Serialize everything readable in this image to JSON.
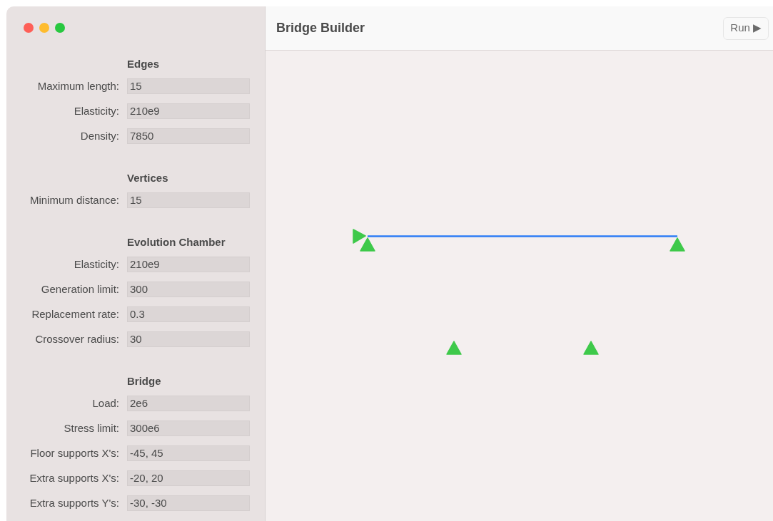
{
  "window": {
    "title": "Bridge Builder"
  },
  "toolbar": {
    "run_button": "Run ▶"
  },
  "sidebar": {
    "sections": [
      {
        "heading": "Edges",
        "fields": [
          {
            "label": "Maximum length:",
            "value": "15"
          },
          {
            "label": "Elasticity:",
            "value": "210e9"
          },
          {
            "label": "Density:",
            "value": "7850"
          }
        ]
      },
      {
        "heading": "Vertices",
        "fields": [
          {
            "label": "Minimum distance:",
            "value": "15"
          }
        ]
      },
      {
        "heading": "Evolution Chamber",
        "fields": [
          {
            "label": "Elasticity:",
            "value": "210e9"
          },
          {
            "label": "Generation limit:",
            "value": "300"
          },
          {
            "label": "Replacement rate:",
            "value": "0.3"
          },
          {
            "label": "Crossover radius:",
            "value": "30"
          }
        ]
      },
      {
        "heading": "Bridge",
        "fields": [
          {
            "label": "Load:",
            "value": "2e6"
          },
          {
            "label": "Stress limit:",
            "value": "300e6"
          },
          {
            "label": "Floor supports X's:",
            "value": "-45, 45"
          },
          {
            "label": "Extra supports X's:",
            "value": "-20, 20"
          },
          {
            "label": "Extra supports Y's:",
            "value": "-30, -30"
          }
        ]
      }
    ]
  }
}
